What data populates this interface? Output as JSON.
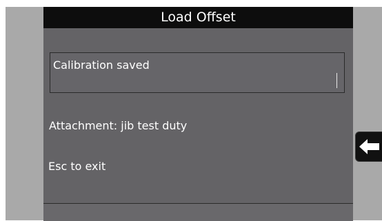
{
  "window": {
    "title": "Load Offset"
  },
  "message_box": {
    "text": "Calibration saved"
  },
  "attachment_line": "Attachment: jib test duty",
  "exit_hint": "Esc to exit",
  "icons": {
    "back": "arrow-left-icon"
  },
  "colors": {
    "title_bar": "#0d0d0d",
    "panel": "#646366",
    "side_bezel": "#a9a9a9",
    "text": "#ffffff"
  }
}
